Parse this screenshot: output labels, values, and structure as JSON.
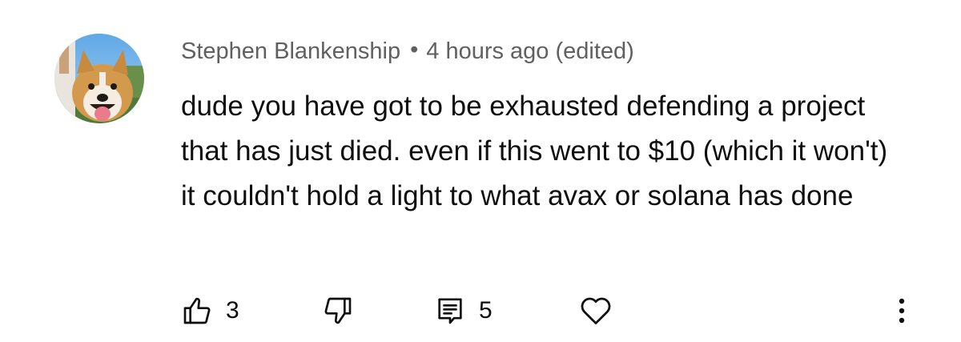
{
  "comment": {
    "author": "Stephen Blankenship",
    "separator": "•",
    "time": "4 hours ago (edited)",
    "text": "dude you have got to be exhausted defending a project that has just died. even if this went to $10 (which it won't) it couldn't hold a light to what avax or solana has done",
    "avatar_icon": "dog-avatar"
  },
  "actions": {
    "like_icon": "thumbs-up-icon",
    "like_count": "3",
    "dislike_icon": "thumbs-down-icon",
    "reply_icon": "reply-icon",
    "reply_count": "5",
    "heart_icon": "heart-icon",
    "more_icon": "more-vertical-icon"
  }
}
